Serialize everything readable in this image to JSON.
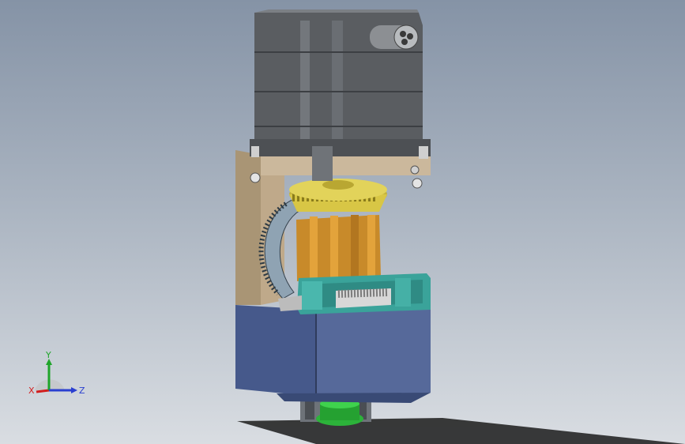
{
  "viewport": {
    "background_top": "#8593a6",
    "background_bottom": "#d9dde2"
  },
  "triad": {
    "x_label": "X",
    "y_label": "Y",
    "z_label": "Z",
    "x_color": "#d21e1e",
    "y_color": "#1fa52a",
    "z_color": "#2a3fd0"
  },
  "model": {
    "motor_color": "#5a5d61",
    "plate_color": "#c9b69a",
    "bevel_gear_color": "#d8c645",
    "side_gear_color": "#8fa3b3",
    "core_color": "#c88a2a",
    "bracket_color": "#3aa39a",
    "gearbox_color": "#4d5f8f",
    "output_shaft_color": "#2cb33a"
  }
}
